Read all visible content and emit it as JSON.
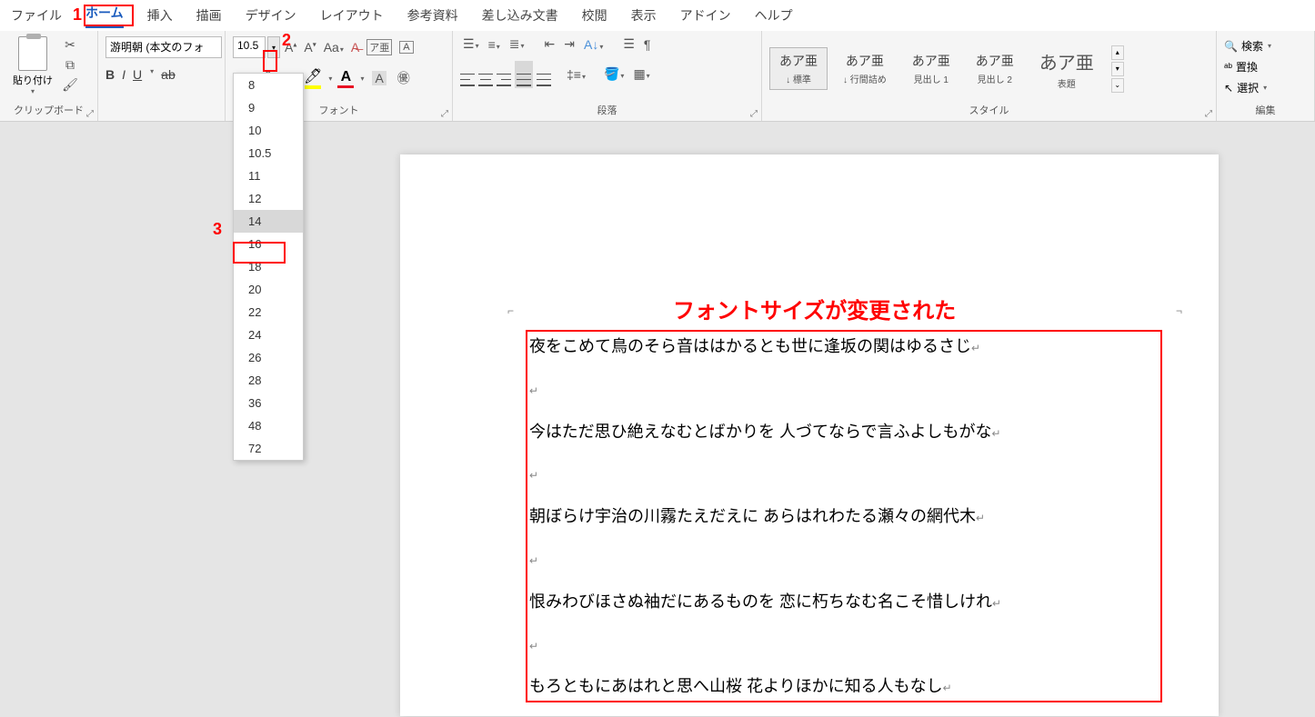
{
  "menu": {
    "tabs": [
      "ファイル",
      "ホーム",
      "挿入",
      "描画",
      "デザイン",
      "レイアウト",
      "参考資料",
      "差し込み文書",
      "校閲",
      "表示",
      "アドイン",
      "ヘルプ"
    ],
    "active_index": 1
  },
  "callouts": {
    "c1": "1",
    "c2": "2",
    "c3": "3"
  },
  "ribbon": {
    "clipboard": {
      "paste": "貼り付け",
      "label": "クリップボード"
    },
    "font": {
      "name_value": "游明朝 (本文のフォ",
      "size_value": "10.5",
      "label": "フォント",
      "sizes": [
        "8",
        "9",
        "10",
        "10.5",
        "11",
        "12",
        "14",
        "16",
        "18",
        "20",
        "22",
        "24",
        "26",
        "28",
        "36",
        "48",
        "72"
      ],
      "selected_size": "14"
    },
    "paragraph": {
      "label": "段落"
    },
    "styles": {
      "label": "スタイル",
      "items": [
        {
          "preview": "あア亜",
          "name": "↓ 標準"
        },
        {
          "preview": "あア亜",
          "name": "↓ 行間詰め"
        },
        {
          "preview": "あア亜",
          "name": "見出し 1"
        },
        {
          "preview": "あア亜",
          "name": "見出し 2"
        },
        {
          "preview": "あア亜",
          "name": "表題"
        }
      ]
    },
    "editing": {
      "label": "編集",
      "find": "検索",
      "replace": "置換",
      "select": "選択"
    }
  },
  "annotation": "フォントサイズが変更された",
  "document": {
    "lines": [
      "夜をこめて鳥のそら音ははかるとも世に逢坂の関はゆるさじ",
      "",
      "今はただ思ひ絶えなむとばかりを  人づてならで言ふよしもがな",
      "",
      "朝ぼらけ宇治の川霧たえだえに  あらはれわたる瀬々の網代木",
      "",
      "恨みわびほさぬ袖だにあるものを  恋に朽ちなむ名こそ惜しけれ",
      "",
      "もろともにあはれと思へ山桜  花よりほかに知る人もなし"
    ]
  }
}
